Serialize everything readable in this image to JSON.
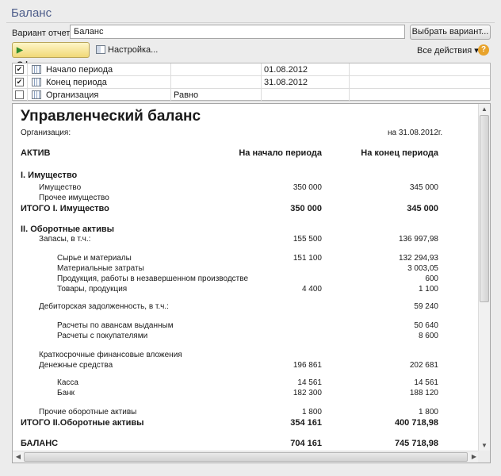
{
  "window": {
    "title": "Баланс"
  },
  "toolbar": {
    "variant_label": "Вариант отчета:",
    "variant_value": "Баланс",
    "choose_variant_label": "Выбрать вариант...",
    "form_label": "Сформировать",
    "settings_label": "Настройка...",
    "all_actions_label": "Все действия ▾",
    "help_label": "?"
  },
  "params": [
    {
      "checked": true,
      "label": "Начало периода",
      "comparison": "",
      "value": "01.08.2012"
    },
    {
      "checked": true,
      "label": "Конец периода",
      "comparison": "",
      "value": "31.08.2012"
    },
    {
      "checked": false,
      "label": "Организация",
      "comparison": "Равно",
      "value": ""
    }
  ],
  "report": {
    "title": "Управленческий баланс",
    "org_label": "Организация:",
    "date_label": "на 31.08.2012г.",
    "col_asset": "АКТИВ",
    "col_start": "На начало периода",
    "col_end": "На конец периода",
    "rows": [
      {
        "label": "I. Имущество",
        "start": "",
        "end": "",
        "style": "bold",
        "indent": 0
      },
      {
        "label": "Имущество",
        "start": "350 000",
        "end": "345 000",
        "style": "normal",
        "indent": 1
      },
      {
        "label": "Прочее имущество",
        "start": "",
        "end": "",
        "style": "normal",
        "indent": 1
      },
      {
        "label": "ИТОГО I. Имущество",
        "start": "350 000",
        "end": "345 000",
        "style": "bold",
        "indent": 0
      },
      {
        "label": "II. Оборотные активы",
        "start": "",
        "end": "",
        "style": "bold",
        "indent": 0
      },
      {
        "label": "Запасы, в т.ч.:",
        "start": "155 500",
        "end": "136 997,98",
        "style": "normal",
        "indent": 1
      },
      {
        "label": "Сырье и материалы",
        "start": "151 100",
        "end": "132 294,93",
        "style": "normal",
        "indent": 2
      },
      {
        "label": "Материальные затраты",
        "start": "",
        "end": "3 003,05",
        "style": "normal",
        "indent": 2
      },
      {
        "label": "Продукция, работы в незавершенном производстве",
        "start": "",
        "end": "600",
        "style": "normal",
        "indent": 2
      },
      {
        "label": "Товары, продукция",
        "start": "4 400",
        "end": "1 100",
        "style": "normal",
        "indent": 2
      },
      {
        "label": "Дебиторская задолженность, в т.ч.:",
        "start": "",
        "end": "59 240",
        "style": "normal",
        "indent": 1
      },
      {
        "label": "Расчеты по авансам выданным",
        "start": "",
        "end": "50 640",
        "style": "normal",
        "indent": 2
      },
      {
        "label": "Расчеты с покупателями",
        "start": "",
        "end": "8 600",
        "style": "normal",
        "indent": 2
      },
      {
        "label": "Краткосрочные финансовые вложения",
        "start": "",
        "end": "",
        "style": "normal",
        "indent": 1
      },
      {
        "label": "Денежные средства",
        "start": "196 861",
        "end": "202 681",
        "style": "normal",
        "indent": 1
      },
      {
        "label": "Касса",
        "start": "14 561",
        "end": "14 561",
        "style": "normal",
        "indent": 2
      },
      {
        "label": "Банк",
        "start": "182 300",
        "end": "188 120",
        "style": "normal",
        "indent": 2
      },
      {
        "label": "Прочие оборотные активы",
        "start": "1 800",
        "end": "1 800",
        "style": "normal",
        "indent": 1
      },
      {
        "label": "ИТОГО II.Оборотные активы",
        "start": "354 161",
        "end": "400 718,98",
        "style": "bold",
        "indent": 0
      },
      {
        "label": "БАЛАНС",
        "start": "704 161",
        "end": "745 718,98",
        "style": "bold",
        "indent": 0
      }
    ]
  }
}
